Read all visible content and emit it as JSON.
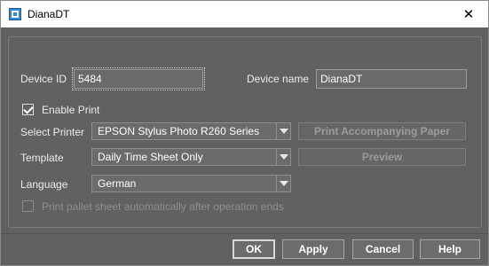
{
  "window": {
    "title": "DianaDT",
    "app_icon": "diana-app-icon",
    "close_glyph": "✕"
  },
  "form": {
    "device_id": {
      "label": "Device ID",
      "value": "5484"
    },
    "device_name": {
      "label": "Device name",
      "value": "DianaDT"
    },
    "enable_print": {
      "label": "Enable Print",
      "checked": true
    },
    "select_printer": {
      "label": "Select Printer",
      "value": "EPSON Stylus Photo R260 Series"
    },
    "print_accompanying_paper": {
      "label": "Print Accompanying Paper",
      "enabled": false
    },
    "template": {
      "label": "Template",
      "value": "Daily Time Sheet Only"
    },
    "preview": {
      "label": "Preview",
      "enabled": false
    },
    "language": {
      "label": "Language",
      "value": "German"
    },
    "print_pallet_sheet": {
      "label": "Print pallet sheet automatically after operation ends",
      "checked": false,
      "enabled": false
    }
  },
  "footer": {
    "ok": "OK",
    "apply": "Apply",
    "cancel": "Cancel",
    "help": "Help"
  },
  "colors": {
    "dialog_bg": "#616161",
    "titlebar_bg": "#ffffff",
    "text": "#ececec",
    "disabled_text": "#9c9c9c"
  }
}
